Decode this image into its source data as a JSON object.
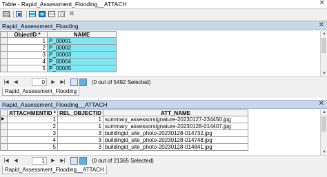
{
  "window": {
    "title": "Table - Rapid_Assessment_Flooding__ATTACH"
  },
  "toolbar": {
    "icons": [
      "table-options-icon",
      "related-tables-icon",
      "select-by-attributes-icon",
      "switch-selection-icon",
      "clear-selection-icon",
      "zoom-to-selected-icon",
      "delete-selected-icon"
    ]
  },
  "upper": {
    "title": "Rapid_Assessment_Flooding",
    "columns": [
      "ObjectID *",
      "NAME"
    ],
    "rows": [
      {
        "oid": "1",
        "name": "P_00001"
      },
      {
        "oid": "2",
        "name": "P_00002"
      },
      {
        "oid": "3",
        "name": "P_00003"
      },
      {
        "oid": "4",
        "name": "P_00004"
      },
      {
        "oid": "5",
        "name": "P_00005"
      }
    ],
    "nav": {
      "record": "0",
      "selection": "(0 out of 5492 Selected)"
    },
    "tab": "Rapid_Assessment_Flooding"
  },
  "lower": {
    "title": "Rapid_Assessment_Flooding__ATTACH",
    "columns": [
      "ATTACHMENTID *",
      "REL_OBJECTID *",
      "ATT_NAME"
    ],
    "rows": [
      {
        "aid": "1",
        "rel": "1",
        "att": "summary_assessorsignature-20230127-234450.jpg"
      },
      {
        "aid": "2",
        "rel": "1",
        "att": "summary_assessorsignature-20230128-014407.jpg"
      },
      {
        "aid": "3",
        "rel": "3",
        "att": "buildingid_site_photo-20230128-014732.jpg"
      },
      {
        "aid": "4",
        "rel": "3",
        "att": "buildingid_site_photo-20230128-014748.jpg"
      },
      {
        "aid": "5",
        "rel": "3",
        "att": "buildingid_site_photo-20230128-014841.jpg"
      }
    ],
    "nav": {
      "record": "1",
      "selection": "(0 out of 21365 Selected)"
    },
    "tab": "Rapid_Assessment_Flooding__ATTACH"
  },
  "colors": {
    "highlight": "#7de8f4",
    "panel_header": "#c8d8ea"
  }
}
